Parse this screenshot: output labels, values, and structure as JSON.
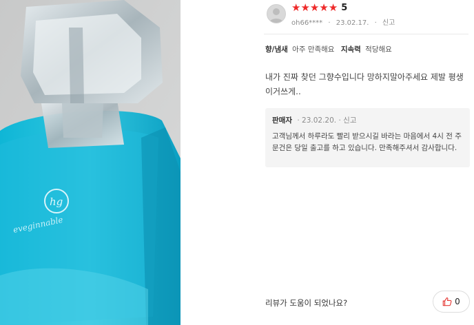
{
  "review": {
    "rating": {
      "stars": 5,
      "max": 5,
      "label": "5",
      "color": "#ee2a2a"
    },
    "author": "oh66****",
    "date": "23.02.17.",
    "separator": "·",
    "report_label": "신고",
    "attributes": [
      {
        "name": "향/냄새",
        "value": "아주 만족해요"
      },
      {
        "name": "지속력",
        "value": "적당해요"
      }
    ],
    "content": "내가 진짜 찾던 그향수입니다 망하지말아주세요 제발 평생이거쓰게..",
    "seller_reply": {
      "seller_label": "판매자",
      "date": "23.02.20.",
      "report_label": "신고",
      "text": "고객님께서 하루라도 빨리 받으시길 바라는 마음에서 4시 전 주문건은 당일 출고를 하고 있습니다. 만족해주셔서 감사합니다."
    },
    "helpful_question": "리뷰가 도움이 되었나요?",
    "like_count": "0"
  },
  "photo": {
    "icon": "perfume-bottle-photo",
    "logo_text": "eveginnable"
  }
}
